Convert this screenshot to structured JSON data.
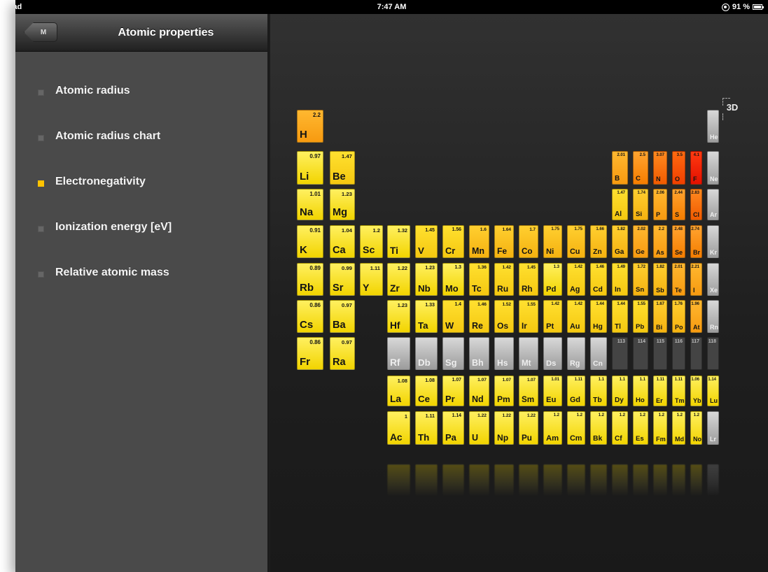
{
  "status_bar": {
    "carrier": "iPad",
    "time": "7:47 AM",
    "battery": "91 %"
  },
  "sidebar": {
    "back_label": "M",
    "title": "Atomic properties",
    "items": [
      {
        "label": "Atomic radius",
        "selected": false
      },
      {
        "label": "Atomic radius chart",
        "selected": false
      },
      {
        "label": "Electronegativity",
        "selected": true
      },
      {
        "label": "Ionization energy [eV]",
        "selected": false
      },
      {
        "label": "Relative atomic mass",
        "selected": false
      }
    ]
  },
  "main": {
    "mode_label": "3D"
  },
  "table": {
    "elements": [
      {
        "symbol": "H",
        "value": "2.2",
        "row": 1,
        "col": 1
      },
      {
        "symbol": "He",
        "value": "",
        "row": 1,
        "col": 18
      },
      {
        "symbol": "Li",
        "value": "0.97",
        "row": 2,
        "col": 1
      },
      {
        "symbol": "Be",
        "value": "1.47",
        "row": 2,
        "col": 2
      },
      {
        "symbol": "B",
        "value": "2.01",
        "row": 2,
        "col": 13
      },
      {
        "symbol": "C",
        "value": "2.5",
        "row": 2,
        "col": 14
      },
      {
        "symbol": "N",
        "value": "3.07",
        "row": 2,
        "col": 15
      },
      {
        "symbol": "O",
        "value": "3.5",
        "row": 2,
        "col": 16
      },
      {
        "symbol": "F",
        "value": "4.1",
        "row": 2,
        "col": 17
      },
      {
        "symbol": "Ne",
        "value": "",
        "row": 2,
        "col": 18
      },
      {
        "symbol": "Na",
        "value": "1.01",
        "row": 3,
        "col": 1
      },
      {
        "symbol": "Mg",
        "value": "1.23",
        "row": 3,
        "col": 2
      },
      {
        "symbol": "Al",
        "value": "1.47",
        "row": 3,
        "col": 13
      },
      {
        "symbol": "Si",
        "value": "1.74",
        "row": 3,
        "col": 14
      },
      {
        "symbol": "P",
        "value": "2.06",
        "row": 3,
        "col": 15
      },
      {
        "symbol": "S",
        "value": "2.44",
        "row": 3,
        "col": 16
      },
      {
        "symbol": "Cl",
        "value": "2.83",
        "row": 3,
        "col": 17
      },
      {
        "symbol": "Ar",
        "value": "",
        "row": 3,
        "col": 18
      },
      {
        "symbol": "K",
        "value": "0.91",
        "row": 4,
        "col": 1
      },
      {
        "symbol": "Ca",
        "value": "1.04",
        "row": 4,
        "col": 2
      },
      {
        "symbol": "Sc",
        "value": "1.2",
        "row": 4,
        "col": 3
      },
      {
        "symbol": "Ti",
        "value": "1.32",
        "row": 4,
        "col": 4
      },
      {
        "symbol": "V",
        "value": "1.45",
        "row": 4,
        "col": 5
      },
      {
        "symbol": "Cr",
        "value": "1.56",
        "row": 4,
        "col": 6
      },
      {
        "symbol": "Mn",
        "value": "1.6",
        "row": 4,
        "col": 7
      },
      {
        "symbol": "Fe",
        "value": "1.64",
        "row": 4,
        "col": 8
      },
      {
        "symbol": "Co",
        "value": "1.7",
        "row": 4,
        "col": 9
      },
      {
        "symbol": "Ni",
        "value": "1.75",
        "row": 4,
        "col": 10
      },
      {
        "symbol": "Cu",
        "value": "1.75",
        "row": 4,
        "col": 11
      },
      {
        "symbol": "Zn",
        "value": "1.66",
        "row": 4,
        "col": 12
      },
      {
        "symbol": "Ga",
        "value": "1.82",
        "row": 4,
        "col": 13
      },
      {
        "symbol": "Ge",
        "value": "2.02",
        "row": 4,
        "col": 14
      },
      {
        "symbol": "As",
        "value": "2.2",
        "row": 4,
        "col": 15
      },
      {
        "symbol": "Se",
        "value": "2.48",
        "row": 4,
        "col": 16
      },
      {
        "symbol": "Br",
        "value": "2.74",
        "row": 4,
        "col": 17
      },
      {
        "symbol": "Kr",
        "value": "",
        "row": 4,
        "col": 18
      },
      {
        "symbol": "Rb",
        "value": "0.89",
        "row": 5,
        "col": 1
      },
      {
        "symbol": "Sr",
        "value": "0.99",
        "row": 5,
        "col": 2
      },
      {
        "symbol": "Y",
        "value": "1.11",
        "row": 5,
        "col": 3
      },
      {
        "symbol": "Zr",
        "value": "1.22",
        "row": 5,
        "col": 4
      },
      {
        "symbol": "Nb",
        "value": "1.23",
        "row": 5,
        "col": 5
      },
      {
        "symbol": "Mo",
        "value": "1.3",
        "row": 5,
        "col": 6
      },
      {
        "symbol": "Tc",
        "value": "1.36",
        "row": 5,
        "col": 7
      },
      {
        "symbol": "Ru",
        "value": "1.42",
        "row": 5,
        "col": 8
      },
      {
        "symbol": "Rh",
        "value": "1.45",
        "row": 5,
        "col": 9
      },
      {
        "symbol": "Pd",
        "value": "1.3",
        "row": 5,
        "col": 10
      },
      {
        "symbol": "Ag",
        "value": "1.42",
        "row": 5,
        "col": 11
      },
      {
        "symbol": "Cd",
        "value": "1.46",
        "row": 5,
        "col": 12
      },
      {
        "symbol": "In",
        "value": "1.49",
        "row": 5,
        "col": 13
      },
      {
        "symbol": "Sn",
        "value": "1.72",
        "row": 5,
        "col": 14
      },
      {
        "symbol": "Sb",
        "value": "1.82",
        "row": 5,
        "col": 15
      },
      {
        "symbol": "Te",
        "value": "2.01",
        "row": 5,
        "col": 16
      },
      {
        "symbol": "I",
        "value": "2.21",
        "row": 5,
        "col": 17
      },
      {
        "symbol": "Xe",
        "value": "",
        "row": 5,
        "col": 18
      },
      {
        "symbol": "Cs",
        "value": "0.86",
        "row": 6,
        "col": 1
      },
      {
        "symbol": "Ba",
        "value": "0.97",
        "row": 6,
        "col": 2
      },
      {
        "symbol": "Hf",
        "value": "1.23",
        "row": 6,
        "col": 4
      },
      {
        "symbol": "Ta",
        "value": "1.33",
        "row": 6,
        "col": 5
      },
      {
        "symbol": "W",
        "value": "1.4",
        "row": 6,
        "col": 6
      },
      {
        "symbol": "Re",
        "value": "1.46",
        "row": 6,
        "col": 7
      },
      {
        "symbol": "Os",
        "value": "1.52",
        "row": 6,
        "col": 8
      },
      {
        "symbol": "Ir",
        "value": "1.55",
        "row": 6,
        "col": 9
      },
      {
        "symbol": "Pt",
        "value": "1.42",
        "row": 6,
        "col": 10
      },
      {
        "symbol": "Au",
        "value": "1.42",
        "row": 6,
        "col": 11
      },
      {
        "symbol": "Hg",
        "value": "1.44",
        "row": 6,
        "col": 12
      },
      {
        "symbol": "Tl",
        "value": "1.44",
        "row": 6,
        "col": 13
      },
      {
        "symbol": "Pb",
        "value": "1.55",
        "row": 6,
        "col": 14
      },
      {
        "symbol": "Bi",
        "value": "1.67",
        "row": 6,
        "col": 15
      },
      {
        "symbol": "Po",
        "value": "1.76",
        "row": 6,
        "col": 16
      },
      {
        "symbol": "At",
        "value": "1.96",
        "row": 6,
        "col": 17
      },
      {
        "symbol": "Rn",
        "value": "",
        "row": 6,
        "col": 18
      },
      {
        "symbol": "Fr",
        "value": "0.86",
        "row": 7,
        "col": 1
      },
      {
        "symbol": "Ra",
        "value": "0.97",
        "row": 7,
        "col": 2
      },
      {
        "symbol": "Rf",
        "value": "",
        "row": 7,
        "col": 4
      },
      {
        "symbol": "Db",
        "value": "",
        "row": 7,
        "col": 5
      },
      {
        "symbol": "Sg",
        "value": "",
        "row": 7,
        "col": 6
      },
      {
        "symbol": "Bh",
        "value": "",
        "row": 7,
        "col": 7
      },
      {
        "symbol": "Hs",
        "value": "",
        "row": 7,
        "col": 8
      },
      {
        "symbol": "Mt",
        "value": "",
        "row": 7,
        "col": 9
      },
      {
        "symbol": "Ds",
        "value": "",
        "row": 7,
        "col": 10
      },
      {
        "symbol": "Rg",
        "value": "",
        "row": 7,
        "col": 11
      },
      {
        "symbol": "Cn",
        "value": "",
        "row": 7,
        "col": 12
      },
      {
        "symbol": "113",
        "value": "",
        "row": 7,
        "col": 13
      },
      {
        "symbol": "114",
        "value": "",
        "row": 7,
        "col": 14
      },
      {
        "symbol": "115",
        "value": "",
        "row": 7,
        "col": 15
      },
      {
        "symbol": "116",
        "value": "",
        "row": 7,
        "col": 16
      },
      {
        "symbol": "117",
        "value": "",
        "row": 7,
        "col": 17
      },
      {
        "symbol": "118",
        "value": "",
        "row": 7,
        "col": 18
      },
      {
        "symbol": "La",
        "value": "1.08",
        "row": 9,
        "col": 4
      },
      {
        "symbol": "Ce",
        "value": "1.08",
        "row": 9,
        "col": 5
      },
      {
        "symbol": "Pr",
        "value": "1.07",
        "row": 9,
        "col": 6
      },
      {
        "symbol": "Nd",
        "value": "1.07",
        "row": 9,
        "col": 7
      },
      {
        "symbol": "Pm",
        "value": "1.07",
        "row": 9,
        "col": 8
      },
      {
        "symbol": "Sm",
        "value": "1.07",
        "row": 9,
        "col": 9
      },
      {
        "symbol": "Eu",
        "value": "1.01",
        "row": 9,
        "col": 10
      },
      {
        "symbol": "Gd",
        "value": "1.11",
        "row": 9,
        "col": 11
      },
      {
        "symbol": "Tb",
        "value": "1.1",
        "row": 9,
        "col": 12
      },
      {
        "symbol": "Dy",
        "value": "1.1",
        "row": 9,
        "col": 13
      },
      {
        "symbol": "Ho",
        "value": "1.1",
        "row": 9,
        "col": 14
      },
      {
        "symbol": "Er",
        "value": "1.11",
        "row": 9,
        "col": 15
      },
      {
        "symbol": "Tm",
        "value": "1.11",
        "row": 9,
        "col": 16
      },
      {
        "symbol": "Yb",
        "value": "1.06",
        "row": 9,
        "col": 17
      },
      {
        "symbol": "Lu",
        "value": "1.14",
        "row": 9,
        "col": 18
      },
      {
        "symbol": "Ac",
        "value": "1",
        "row": 10,
        "col": 4
      },
      {
        "symbol": "Th",
        "value": "1.11",
        "row": 10,
        "col": 5
      },
      {
        "symbol": "Pa",
        "value": "1.14",
        "row": 10,
        "col": 6
      },
      {
        "symbol": "U",
        "value": "1.22",
        "row": 10,
        "col": 7
      },
      {
        "symbol": "Np",
        "value": "1.22",
        "row": 10,
        "col": 8
      },
      {
        "symbol": "Pu",
        "value": "1.22",
        "row": 10,
        "col": 9
      },
      {
        "symbol": "Am",
        "value": "1.2",
        "row": 10,
        "col": 10
      },
      {
        "symbol": "Cm",
        "value": "1.2",
        "row": 10,
        "col": 11
      },
      {
        "symbol": "Bk",
        "value": "1.2",
        "row": 10,
        "col": 12
      },
      {
        "symbol": "Cf",
        "value": "1.2",
        "row": 10,
        "col": 13
      },
      {
        "symbol": "Es",
        "value": "1.2",
        "row": 10,
        "col": 14
      },
      {
        "symbol": "Fm",
        "value": "1.2",
        "row": 10,
        "col": 15
      },
      {
        "symbol": "Md",
        "value": "1.2",
        "row": 10,
        "col": 16
      },
      {
        "symbol": "No",
        "value": "1.2",
        "row": 10,
        "col": 17
      },
      {
        "symbol": "Lr",
        "value": "",
        "row": 10,
        "col": 18
      }
    ]
  }
}
